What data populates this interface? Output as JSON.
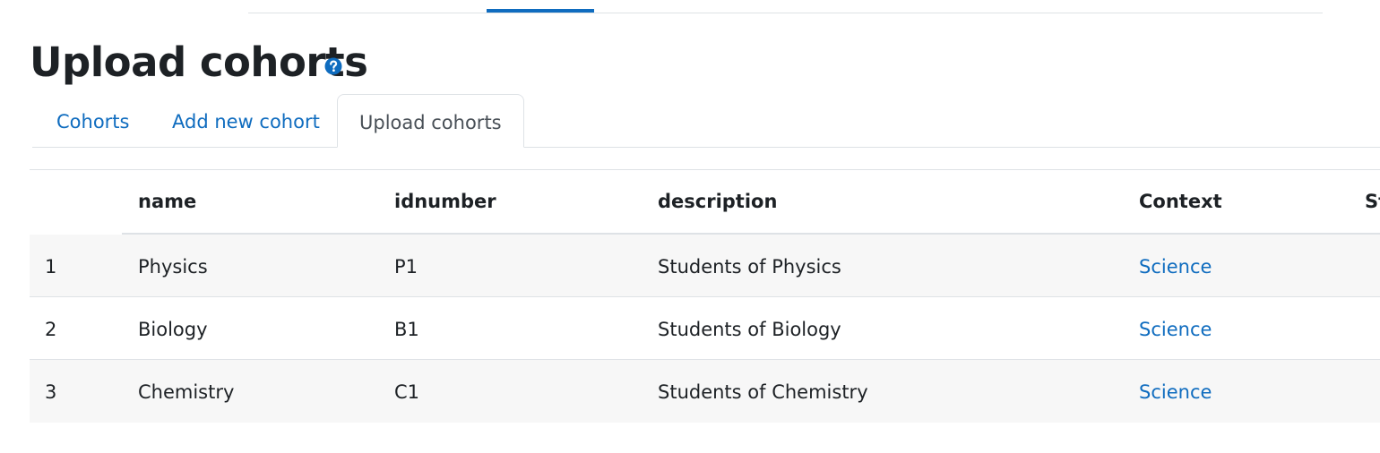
{
  "page": {
    "title": "Upload cohorts"
  },
  "icons": {
    "help": "question-circle-icon",
    "help_color": "#0f6cbf"
  },
  "colors": {
    "link": "#0f6cbf",
    "text": "#1d2125",
    "border": "#dee2e6",
    "stripe": "#f7f7f7"
  },
  "tabs": [
    {
      "label": "Cohorts",
      "active": false
    },
    {
      "label": "Add new cohort",
      "active": false
    },
    {
      "label": "Upload cohorts",
      "active": true
    }
  ],
  "table": {
    "headers": [
      "",
      "name",
      "idnumber",
      "description",
      "Context",
      "St"
    ],
    "rows": [
      {
        "num": "1",
        "name": "Physics",
        "idnumber": "P1",
        "description": "Students of Physics",
        "context": "Science"
      },
      {
        "num": "2",
        "name": "Biology",
        "idnumber": "B1",
        "description": "Students of Biology",
        "context": "Science"
      },
      {
        "num": "3",
        "name": "Chemistry",
        "idnumber": "C1",
        "description": "Students of Chemistry",
        "context": "Science"
      }
    ]
  }
}
